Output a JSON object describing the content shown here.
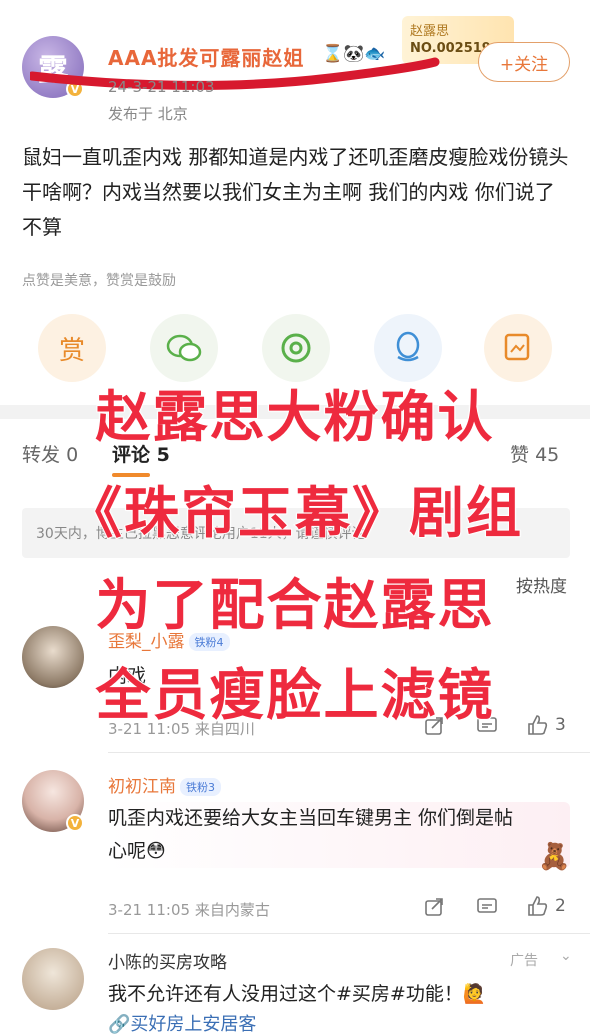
{
  "post": {
    "poster_name": "AAA批发可露丽赵姐",
    "emojis": "⌛🐼🐟",
    "fan_card_name": "赵露思",
    "fan_card_no": "NO.002519",
    "follow_label": "+关注",
    "time": "24-3-21 11:03",
    "location": "发布于 北京",
    "body": "鼠妇一直叽歪内戏 那都知道是内戏了还叽歪磨皮瘦脸戏份镜头干啥啊？内戏当然要以我们女主为主啊 我们的内戏 你们说了不算",
    "hint": "点赞是美意，赞赏是鼓励",
    "reward_label": "赏"
  },
  "stats": {
    "repost_label": "转发",
    "repost_count": "0",
    "comment_label": "评论",
    "comment_count": "5",
    "like_label": "赞",
    "like_count": "45"
  },
  "notice": "30天内，博主已拉黑恶意评论用户11人，请谨慎评论",
  "sort_label": "按热度",
  "overlay_lines": [
    "赵露思大粉确认",
    "《珠帘玉幕》剧组",
    "为了配合赵露思",
    "全员瘦脸上滤镜"
  ],
  "comments": [
    {
      "name": "歪梨_小露",
      "level": "铁粉4",
      "text": "内戏",
      "time": "3-21 11:05",
      "location": "来自四川",
      "likes": "3"
    },
    {
      "name": "初初江南",
      "level": "铁粉3",
      "text": "叽歪内戏还要给大女主当回车键男主 你们倒是帖心呢😳",
      "time": "3-21 11:05",
      "location": "来自内蒙古",
      "likes": "2"
    }
  ],
  "ad": {
    "name": "小陈的买房攻略",
    "tag": "广告",
    "text": "我不允许还有人没用过这个#买房#功能！🙋",
    "link": "买好房上安居客"
  }
}
